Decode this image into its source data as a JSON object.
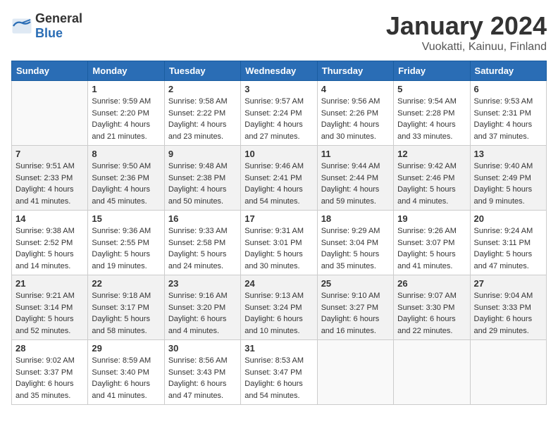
{
  "header": {
    "logo_general": "General",
    "logo_blue": "Blue",
    "title": "January 2024",
    "location": "Vuokatti, Kainuu, Finland"
  },
  "days_of_week": [
    "Sunday",
    "Monday",
    "Tuesday",
    "Wednesday",
    "Thursday",
    "Friday",
    "Saturday"
  ],
  "weeks": [
    {
      "stripe": false,
      "days": [
        {
          "num": "",
          "sunrise": "",
          "sunset": "",
          "daylight": ""
        },
        {
          "num": "1",
          "sunrise": "Sunrise: 9:59 AM",
          "sunset": "Sunset: 2:20 PM",
          "daylight": "Daylight: 4 hours and 21 minutes."
        },
        {
          "num": "2",
          "sunrise": "Sunrise: 9:58 AM",
          "sunset": "Sunset: 2:22 PM",
          "daylight": "Daylight: 4 hours and 23 minutes."
        },
        {
          "num": "3",
          "sunrise": "Sunrise: 9:57 AM",
          "sunset": "Sunset: 2:24 PM",
          "daylight": "Daylight: 4 hours and 27 minutes."
        },
        {
          "num": "4",
          "sunrise": "Sunrise: 9:56 AM",
          "sunset": "Sunset: 2:26 PM",
          "daylight": "Daylight: 4 hours and 30 minutes."
        },
        {
          "num": "5",
          "sunrise": "Sunrise: 9:54 AM",
          "sunset": "Sunset: 2:28 PM",
          "daylight": "Daylight: 4 hours and 33 minutes."
        },
        {
          "num": "6",
          "sunrise": "Sunrise: 9:53 AM",
          "sunset": "Sunset: 2:31 PM",
          "daylight": "Daylight: 4 hours and 37 minutes."
        }
      ]
    },
    {
      "stripe": true,
      "days": [
        {
          "num": "7",
          "sunrise": "Sunrise: 9:51 AM",
          "sunset": "Sunset: 2:33 PM",
          "daylight": "Daylight: 4 hours and 41 minutes."
        },
        {
          "num": "8",
          "sunrise": "Sunrise: 9:50 AM",
          "sunset": "Sunset: 2:36 PM",
          "daylight": "Daylight: 4 hours and 45 minutes."
        },
        {
          "num": "9",
          "sunrise": "Sunrise: 9:48 AM",
          "sunset": "Sunset: 2:38 PM",
          "daylight": "Daylight: 4 hours and 50 minutes."
        },
        {
          "num": "10",
          "sunrise": "Sunrise: 9:46 AM",
          "sunset": "Sunset: 2:41 PM",
          "daylight": "Daylight: 4 hours and 54 minutes."
        },
        {
          "num": "11",
          "sunrise": "Sunrise: 9:44 AM",
          "sunset": "Sunset: 2:44 PM",
          "daylight": "Daylight: 4 hours and 59 minutes."
        },
        {
          "num": "12",
          "sunrise": "Sunrise: 9:42 AM",
          "sunset": "Sunset: 2:46 PM",
          "daylight": "Daylight: 5 hours and 4 minutes."
        },
        {
          "num": "13",
          "sunrise": "Sunrise: 9:40 AM",
          "sunset": "Sunset: 2:49 PM",
          "daylight": "Daylight: 5 hours and 9 minutes."
        }
      ]
    },
    {
      "stripe": false,
      "days": [
        {
          "num": "14",
          "sunrise": "Sunrise: 9:38 AM",
          "sunset": "Sunset: 2:52 PM",
          "daylight": "Daylight: 5 hours and 14 minutes."
        },
        {
          "num": "15",
          "sunrise": "Sunrise: 9:36 AM",
          "sunset": "Sunset: 2:55 PM",
          "daylight": "Daylight: 5 hours and 19 minutes."
        },
        {
          "num": "16",
          "sunrise": "Sunrise: 9:33 AM",
          "sunset": "Sunset: 2:58 PM",
          "daylight": "Daylight: 5 hours and 24 minutes."
        },
        {
          "num": "17",
          "sunrise": "Sunrise: 9:31 AM",
          "sunset": "Sunset: 3:01 PM",
          "daylight": "Daylight: 5 hours and 30 minutes."
        },
        {
          "num": "18",
          "sunrise": "Sunrise: 9:29 AM",
          "sunset": "Sunset: 3:04 PM",
          "daylight": "Daylight: 5 hours and 35 minutes."
        },
        {
          "num": "19",
          "sunrise": "Sunrise: 9:26 AM",
          "sunset": "Sunset: 3:07 PM",
          "daylight": "Daylight: 5 hours and 41 minutes."
        },
        {
          "num": "20",
          "sunrise": "Sunrise: 9:24 AM",
          "sunset": "Sunset: 3:11 PM",
          "daylight": "Daylight: 5 hours and 47 minutes."
        }
      ]
    },
    {
      "stripe": true,
      "days": [
        {
          "num": "21",
          "sunrise": "Sunrise: 9:21 AM",
          "sunset": "Sunset: 3:14 PM",
          "daylight": "Daylight: 5 hours and 52 minutes."
        },
        {
          "num": "22",
          "sunrise": "Sunrise: 9:18 AM",
          "sunset": "Sunset: 3:17 PM",
          "daylight": "Daylight: 5 hours and 58 minutes."
        },
        {
          "num": "23",
          "sunrise": "Sunrise: 9:16 AM",
          "sunset": "Sunset: 3:20 PM",
          "daylight": "Daylight: 6 hours and 4 minutes."
        },
        {
          "num": "24",
          "sunrise": "Sunrise: 9:13 AM",
          "sunset": "Sunset: 3:24 PM",
          "daylight": "Daylight: 6 hours and 10 minutes."
        },
        {
          "num": "25",
          "sunrise": "Sunrise: 9:10 AM",
          "sunset": "Sunset: 3:27 PM",
          "daylight": "Daylight: 6 hours and 16 minutes."
        },
        {
          "num": "26",
          "sunrise": "Sunrise: 9:07 AM",
          "sunset": "Sunset: 3:30 PM",
          "daylight": "Daylight: 6 hours and 22 minutes."
        },
        {
          "num": "27",
          "sunrise": "Sunrise: 9:04 AM",
          "sunset": "Sunset: 3:33 PM",
          "daylight": "Daylight: 6 hours and 29 minutes."
        }
      ]
    },
    {
      "stripe": false,
      "days": [
        {
          "num": "28",
          "sunrise": "Sunrise: 9:02 AM",
          "sunset": "Sunset: 3:37 PM",
          "daylight": "Daylight: 6 hours and 35 minutes."
        },
        {
          "num": "29",
          "sunrise": "Sunrise: 8:59 AM",
          "sunset": "Sunset: 3:40 PM",
          "daylight": "Daylight: 6 hours and 41 minutes."
        },
        {
          "num": "30",
          "sunrise": "Sunrise: 8:56 AM",
          "sunset": "Sunset: 3:43 PM",
          "daylight": "Daylight: 6 hours and 47 minutes."
        },
        {
          "num": "31",
          "sunrise": "Sunrise: 8:53 AM",
          "sunset": "Sunset: 3:47 PM",
          "daylight": "Daylight: 6 hours and 54 minutes."
        },
        {
          "num": "",
          "sunrise": "",
          "sunset": "",
          "daylight": ""
        },
        {
          "num": "",
          "sunrise": "",
          "sunset": "",
          "daylight": ""
        },
        {
          "num": "",
          "sunrise": "",
          "sunset": "",
          "daylight": ""
        }
      ]
    }
  ]
}
